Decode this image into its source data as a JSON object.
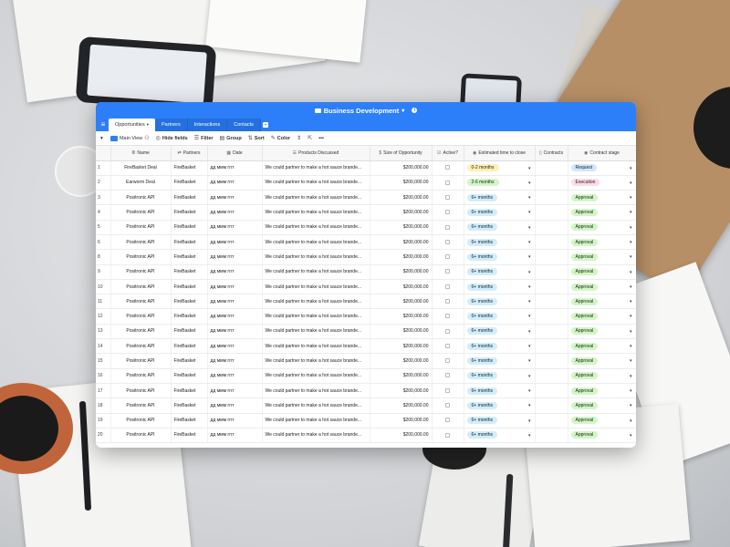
{
  "app": {
    "title": "Business Development",
    "title_caret": "▾",
    "info_icon": "info-icon",
    "colors": {
      "accent": "#2d7ff9",
      "pill_time": "#cfeefc",
      "pill_time_first": "#fff0b3",
      "pill_time_second": "#d1f7c4",
      "pill_approval": "#d1f7c4",
      "pill_request": "#d0e8ff",
      "pill_execution": "#ffdce5"
    }
  },
  "tabs": [
    {
      "label": "Opportunities",
      "active": true
    },
    {
      "label": "Partners",
      "active": false
    },
    {
      "label": "Interactions",
      "active": false
    },
    {
      "label": "Contacts",
      "active": false
    }
  ],
  "toolbar": {
    "view_name": "Main View",
    "hide_fields": "Hide fields",
    "filter": "Filter",
    "group": "Group",
    "sort": "Sort",
    "color": "Color",
    "more": "•••"
  },
  "columns": {
    "name": "Name",
    "partners": "Partners",
    "date": "Date",
    "products": "Products Discussed",
    "size": "Size of Opportunity",
    "active": "Active?",
    "time": "Estimated time to close",
    "contracts": "Contracts",
    "stage": "Contract stage"
  },
  "rows": [
    {
      "num": "1",
      "name": "FireBasket Deal",
      "partner": "FireBasket",
      "date": "дд ммм гггг",
      "products": "We could partner to make a hot sauce brande...",
      "size": "$200,000.00",
      "time": "0-2 months",
      "stage": "Request"
    },
    {
      "num": "2",
      "name": "Earworm Deal",
      "partner": "FireBasket",
      "date": "дд ммм гггг",
      "products": "We could partner to make a hot sauce brande...",
      "size": "$200,000.00",
      "time": "2-6 months",
      "stage": "Execution"
    },
    {
      "num": "3",
      "name": "Positronic API",
      "partner": "FireBasket",
      "date": "дд ммм гггг",
      "products": "We could partner to make a hot sauce brande...",
      "size": "$200,000.00",
      "time": "6+ months",
      "stage": "Approval"
    },
    {
      "num": "4",
      "name": "Positronic API",
      "partner": "FireBasket",
      "date": "дд ммм гггг",
      "products": "We could partner to make a hot sauce brande...",
      "size": "$200,000.00",
      "time": "6+ months",
      "stage": "Approval"
    },
    {
      "num": "5",
      "name": "Positronic API",
      "partner": "FireBasket",
      "date": "дд ммм гггг",
      "products": "We could partner to make a hot sauce brande...",
      "size": "$200,000.00",
      "time": "6+ months",
      "stage": "Approval"
    },
    {
      "num": "6",
      "name": "Positronic API",
      "partner": "FireBasket",
      "date": "дд ммм гггг",
      "products": "We could partner to make a hot sauce brande...",
      "size": "$200,000.00",
      "time": "6+ months",
      "stage": "Approval"
    },
    {
      "num": "8",
      "name": "Positronic API",
      "partner": "FireBasket",
      "date": "дд ммм гггг",
      "products": "We could partner to make a hot sauce brande...",
      "size": "$200,000.00",
      "time": "6+ months",
      "stage": "Approval"
    },
    {
      "num": "9",
      "name": "Positronic API",
      "partner": "FireBasket",
      "date": "дд ммм гггг",
      "products": "We could partner to make a hot sauce brande...",
      "size": "$200,000.00",
      "time": "6+ months",
      "stage": "Approval"
    },
    {
      "num": "10",
      "name": "Positronic API",
      "partner": "FireBasket",
      "date": "дд ммм гггг",
      "products": "We could partner to make a hot sauce brande...",
      "size": "$200,000.00",
      "time": "6+ months",
      "stage": "Approval"
    },
    {
      "num": "11",
      "name": "Positronic API",
      "partner": "FireBasket",
      "date": "дд ммм гггг",
      "products": "We could partner to make a hot sauce brande...",
      "size": "$200,000.00",
      "time": "6+ months",
      "stage": "Approval"
    },
    {
      "num": "12",
      "name": "Positronic API",
      "partner": "FireBasket",
      "date": "дд ммм гггг",
      "products": "We could partner to make a hot sauce brande...",
      "size": "$200,000.00",
      "time": "6+ months",
      "stage": "Approval"
    },
    {
      "num": "13",
      "name": "Positronic API",
      "partner": "FireBasket",
      "date": "дд ммм гггг",
      "products": "We could partner to make a hot sauce brande...",
      "size": "$200,000.00",
      "time": "6+ months",
      "stage": "Approval"
    },
    {
      "num": "14",
      "name": "Positronic API",
      "partner": "FireBasket",
      "date": "дд ммм гггг",
      "products": "We could partner to make a hot sauce brande...",
      "size": "$200,000.00",
      "time": "6+ months",
      "stage": "Approval"
    },
    {
      "num": "15",
      "name": "Positronic API",
      "partner": "FireBasket",
      "date": "дд ммм гггг",
      "products": "We could partner to make a hot sauce brande...",
      "size": "$200,000.00",
      "time": "6+ months",
      "stage": "Approval"
    },
    {
      "num": "16",
      "name": "Positronic API",
      "partner": "FireBasket",
      "date": "дд ммм гггг",
      "products": "We could partner to make a hot sauce brande...",
      "size": "$200,000.00",
      "time": "6+ months",
      "stage": "Approval"
    },
    {
      "num": "17",
      "name": "Positronic API",
      "partner": "FireBasket",
      "date": "дд ммм гггг",
      "products": "We could partner to make a hot sauce brande...",
      "size": "$200,000.00",
      "time": "6+ months",
      "stage": "Approval"
    },
    {
      "num": "18",
      "name": "Positronic API",
      "partner": "FireBasket",
      "date": "дд ммм гггг",
      "products": "We could partner to make a hot sauce brande...",
      "size": "$200,000.00",
      "time": "6+ months",
      "stage": "Approval"
    },
    {
      "num": "19",
      "name": "Positronic API",
      "partner": "FireBasket",
      "date": "дд ммм гггг",
      "products": "We could partner to make a hot sauce brande...",
      "size": "$200,000.00",
      "time": "6+ months",
      "stage": "Approval"
    },
    {
      "num": "20",
      "name": "Positronic API",
      "partner": "FireBasket",
      "date": "дд ммм гггг",
      "products": "We could partner to make a hot sauce brande...",
      "size": "$200,000.00",
      "time": "6+ months",
      "stage": "Approval"
    }
  ]
}
